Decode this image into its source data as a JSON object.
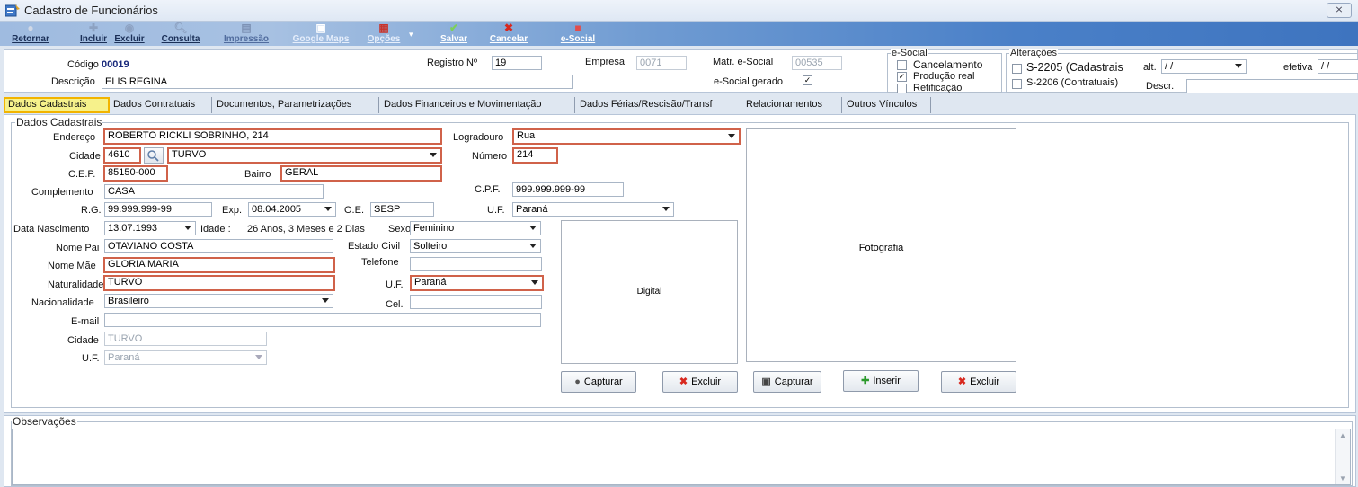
{
  "window": {
    "title": "Cadastro de Funcionários",
    "close_symbol": "⨯"
  },
  "toolbar": {
    "retornar": "Retornar",
    "incluir": "Incluir",
    "excluir": "Excluir",
    "consulta": "Consulta",
    "impressao": "Impressão",
    "google_maps": "Google Maps",
    "opcoes": "Opções",
    "salvar": "Salvar",
    "cancelar": "Cancelar",
    "esocial": "e-Social"
  },
  "header": {
    "codigo_label": "Código",
    "codigo_value": "00019",
    "registro_label": "Registro Nº",
    "registro_value": "19",
    "empresa_label": "Empresa",
    "empresa_value": "0071",
    "matr_label": "Matr. e-Social",
    "matr_value": "00535",
    "descricao_label": "Descrição",
    "descricao_value": "ELIS REGINA",
    "esocial_gerado_label": "e-Social gerado",
    "esocial_gerado_checked": true,
    "esocial_group": {
      "title": "e-Social",
      "cancelamento": "Cancelamento",
      "cancelamento_checked": false,
      "producao": "Produção real",
      "producao_checked": true,
      "retificacao": "Retificação",
      "retificacao_checked": false
    },
    "alteracoes_group": {
      "title": "Alterações",
      "s2205": "S-2205 (Cadastrais",
      "s2206": "S-2206 (Contratuais)",
      "alt_label": "alt.",
      "alt_value": " /  /",
      "efetiva_label": "efetiva",
      "efetiva_value": " /  /",
      "descr_label": "Descr."
    }
  },
  "tabs": [
    "Dados Cadastrais",
    "Dados Contratuais",
    "Documentos, Parametrizações",
    "Dados Financeiros e Movimentação",
    "Dados Férias/Rescisão/Transf",
    "Relacionamentos",
    "Outros Vínculos"
  ],
  "cadastro": {
    "group_title": "Dados Cadastrais",
    "endereco_label": "Endereço",
    "endereco_value": "ROBERTO RICKLI SOBRINHO, 214",
    "logradouro_label": "Logradouro",
    "logradouro_value": "Rua",
    "cidade_label": "Cidade",
    "cidade_code": "4610",
    "cidade_value": "TURVO",
    "numero_label": "Número",
    "numero_value": "214",
    "cep_label": "C.E.P.",
    "cep_value": "85150-000",
    "bairro_label": "Bairro",
    "bairro_value": "GERAL",
    "complemento_label": "Complemento",
    "complemento_value": "CASA",
    "cpf_label": "C.P.F.",
    "cpf_value": "999.999.999-99",
    "rg_label": "R.G.",
    "rg_value": "99.999.999-99",
    "exp_label": "Exp.",
    "exp_value": "08.04.2005",
    "oe_label": "O.E.",
    "oe_value": "SESP",
    "uf_label": "U.F.",
    "uf_value": "Paraná",
    "nascimento_label": "Data Nascimento",
    "nascimento_value": "13.07.1993",
    "idade_label": "Idade :",
    "idade_value": "26 Anos, 3 Meses  e 2 Dias",
    "sexo_label": "Sexo",
    "sexo_value": "Feminino",
    "pai_label": "Nome Pai",
    "pai_value": "OTAVIANO COSTA",
    "estado_civil_label": "Estado Civil",
    "estado_civil_value": "Solteiro",
    "mae_label": "Nome Mãe",
    "mae_value": "GLORIA MARIA",
    "telefone_label": "Telefone",
    "telefone_value": "",
    "naturalidade_label": "Naturalidade",
    "naturalidade_value": "TURVO",
    "uf2_label": "U.F.",
    "uf2_value": "Paraná",
    "nacionalidade_label": "Nacionalidade",
    "nacionalidade_value": "Brasileiro",
    "cel_label": "Cel.",
    "cel_value": "",
    "email_label": "E-mail",
    "email_value": "",
    "cidade2_label": "Cidade",
    "cidade2_value": "TURVO",
    "uf3_label": "U.F.",
    "uf3_value": "Paraná",
    "digital_label": "Digital",
    "fotografia_label": "Fotografia",
    "btn_capturar1": "Capturar",
    "btn_excluir1": "Excluir",
    "btn_capturar2": "Capturar",
    "btn_inserir": "Inserir",
    "btn_excluir2": "Excluir"
  },
  "observacoes": {
    "title": "Observações"
  }
}
